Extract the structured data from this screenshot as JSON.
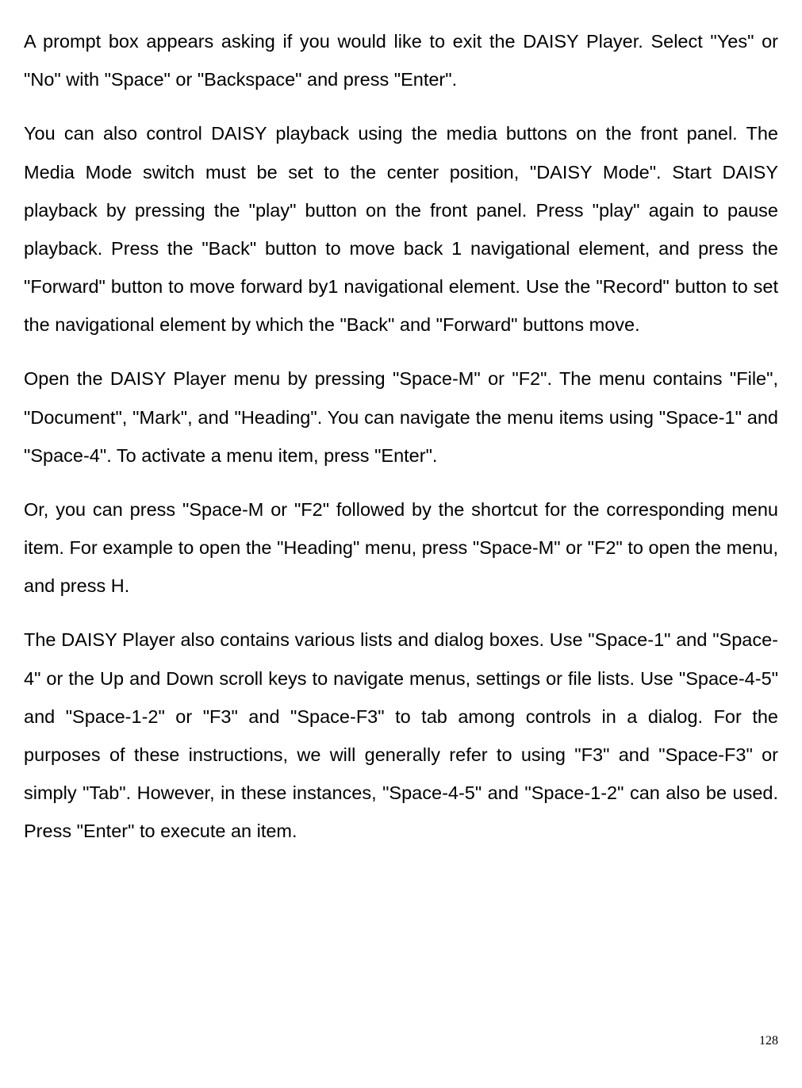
{
  "paragraphs": {
    "p1": "A prompt box appears asking if you would like to exit the DAISY Player. Select \"Yes\" or \"No\" with \"Space\" or \"Backspace\" and press \"Enter\".",
    "p2": "You can also control DAISY playback using the media buttons on the front panel. The Media Mode switch must be set to the center position, \"DAISY Mode\". Start DAISY playback by pressing the \"play\" button on the front panel. Press \"play\" again to pause playback. Press the \"Back\" button to move back 1 navigational element, and press the \"Forward\" button to move forward by1 navigational element. Use the \"Record\" button to set the navigational element by which the \"Back\" and \"Forward\" buttons move.",
    "p3": "Open the DAISY Player menu by pressing \"Space-M\" or \"F2\". The menu contains \"File\", \"Document\", \"Mark\", and \"Heading\". You can navigate the menu items using \"Space-1\" and \"Space-4\". To activate a menu item, press \"Enter\".",
    "p4": "Or, you can press \"Space-M or \"F2\" followed by the shortcut for the corresponding menu item. For example to open the \"Heading\" menu, press \"Space-M\" or \"F2\" to open the menu, and press H.",
    "p5": "The DAISY Player also contains various lists and dialog boxes. Use \"Space-1\" and \"Space-4\" or the Up and Down scroll keys to navigate menus, settings or file lists. Use \"Space-4-5\" and \"Space-1-2\" or \"F3\" and \"Space-F3\" to tab among controls in a dialog. For the purposes of these instructions, we will generally refer to using \"F3\" and \"Space-F3\" or simply \"Tab\". However, in these instances, \"Space-4-5\" and \"Space-1-2\" can also be used. Press \"Enter\" to execute an item."
  },
  "page_number": "128"
}
